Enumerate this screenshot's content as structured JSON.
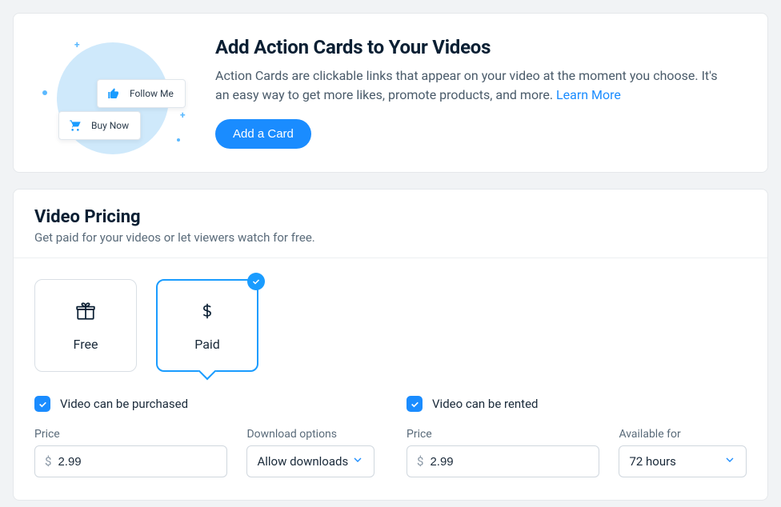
{
  "action_cards": {
    "title": "Add Action Cards to Your Videos",
    "description": "Action Cards are clickable links that appear on your video at the moment you choose. It's an easy way to get more likes, promote products, and more. ",
    "learn_more": "Learn More",
    "button": "Add a Card",
    "illus": {
      "follow_label": "Follow Me",
      "buy_label": "Buy Now"
    }
  },
  "pricing": {
    "title": "Video Pricing",
    "subtitle": "Get paid for your videos or let viewers watch for free.",
    "tiers": {
      "free": "Free",
      "paid": "Paid"
    },
    "purchase": {
      "checkbox_label": "Video can be purchased",
      "price_label": "Price",
      "currency_symbol": "$",
      "price_value": "2.99",
      "download_label": "Download options",
      "download_selected": "Allow downloads"
    },
    "rent": {
      "checkbox_label": "Video can be rented",
      "price_label": "Price",
      "currency_symbol": "$",
      "price_value": "2.99",
      "available_label": "Available for",
      "available_selected": "72 hours"
    }
  }
}
